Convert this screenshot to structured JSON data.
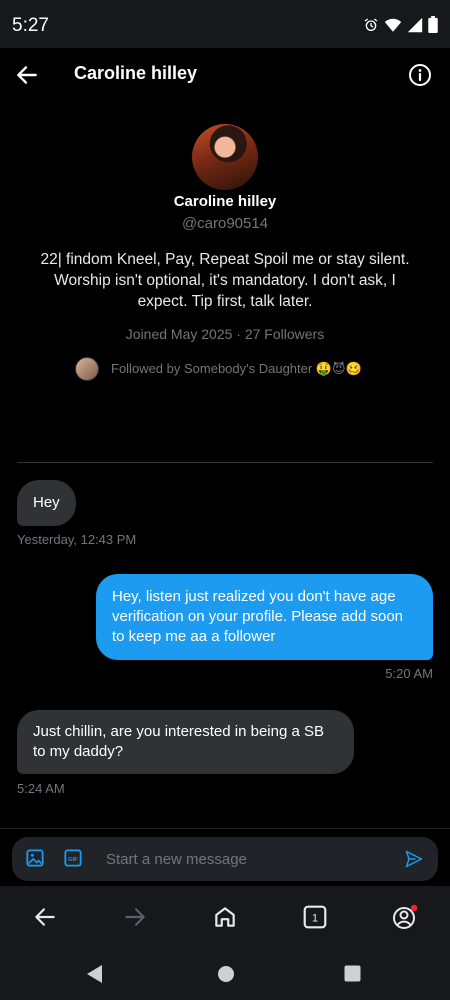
{
  "status": {
    "time": "5:27"
  },
  "header": {
    "title": "Caroline hilley"
  },
  "profile": {
    "name": "Caroline hilley",
    "handle": "@caro90514",
    "bio": "22| findom Kneel, Pay, Repeat Spoil me or stay silent. Worship isn't optional, it's mandatory. I don't ask, I expect. Tip first, talk later.",
    "meta": "Joined May 2025 · 27 Followers",
    "followed_by": "Followed by Somebody's Daughter 🤑😈🥴"
  },
  "messages": [
    {
      "direction": "in",
      "text": "Hey",
      "time": "Yesterday, 12:43 PM"
    },
    {
      "direction": "out",
      "text": "Hey, listen just realized you don't have age verification on your profile. Please add soon to keep me aa a follower",
      "time": "5:20 AM"
    },
    {
      "direction": "in",
      "text": "Just chillin, are you interested in being a SB to my daddy?",
      "time": "5:24 AM"
    }
  ],
  "composer": {
    "placeholder": "Start a new message",
    "gif_label": "GIF"
  },
  "browser_nav": {
    "tab_count": "1"
  },
  "colors": {
    "accent": "#1d9bf0",
    "bubble_in": "#2f3336",
    "muted": "#71767b",
    "notification_dot": "#f4212e"
  }
}
